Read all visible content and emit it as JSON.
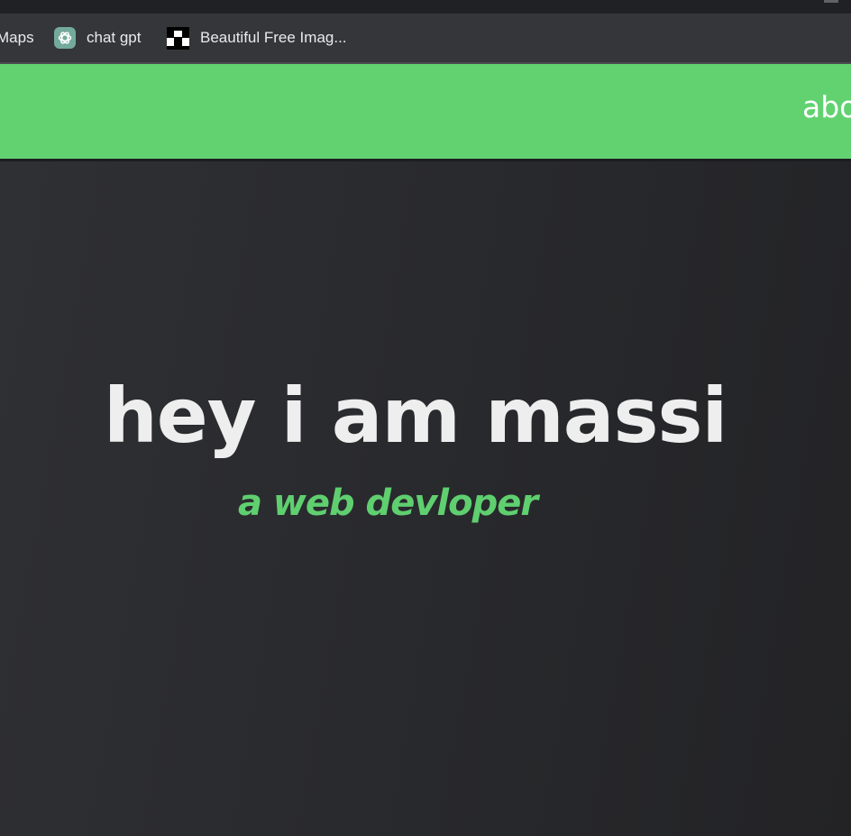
{
  "bookmarks": {
    "items": [
      {
        "label": "Maps",
        "icon": "maps-icon"
      },
      {
        "label": "chat gpt",
        "icon": "chatgpt-icon"
      },
      {
        "label": "Beautiful Free Imag...",
        "icon": "unsplash-icon"
      }
    ]
  },
  "navbar": {
    "background": "#62d271",
    "link_label": "abo"
  },
  "hero": {
    "title": "hey i am massi",
    "subtitle": "a web devloper",
    "accent_color": "#5fcf6f"
  }
}
